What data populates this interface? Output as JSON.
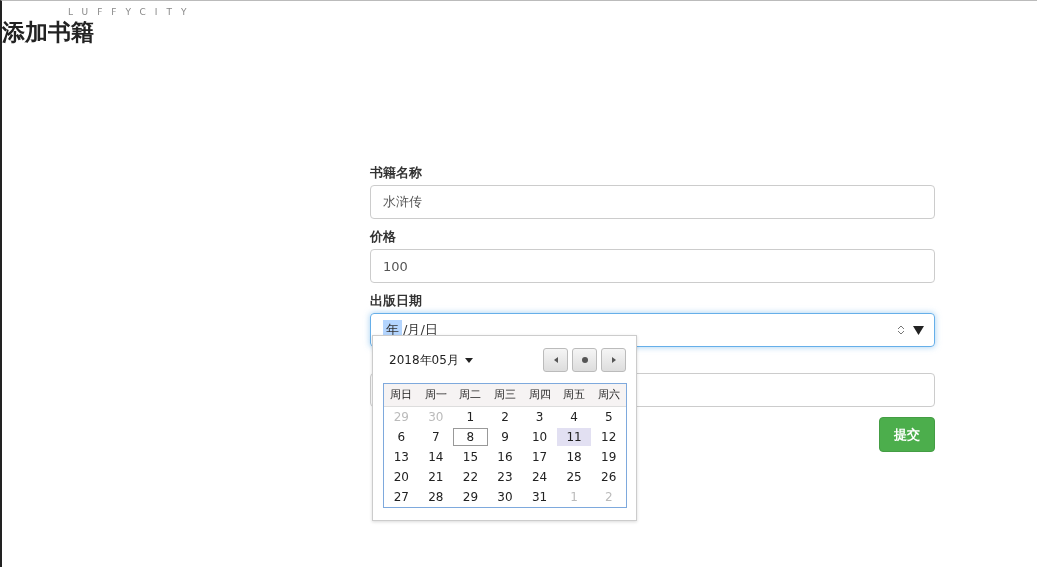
{
  "logo": "LUFFYCITY",
  "title": "添加书籍",
  "fields": [
    {
      "label": "书籍名称",
      "value": "水浒传"
    },
    {
      "label": "价格",
      "value": "100"
    },
    {
      "label": "出版日期",
      "kind": "date",
      "segments": [
        "年",
        "/月/日"
      ],
      "focused": true
    }
  ],
  "datepicker": {
    "month": "2018年05月",
    "weekdays": [
      "周日",
      "周一",
      "周二",
      "周三",
      "周四",
      "周五",
      "周六"
    ],
    "weeks": [
      [
        {
          "label": "29",
          "other_month": true,
          "today": false,
          "hovered": false
        },
        {
          "label": "30",
          "other_month": true,
          "today": false,
          "hovered": false
        },
        {
          "label": "1",
          "other_month": false,
          "today": false,
          "hovered": false
        },
        {
          "label": "2",
          "other_month": false,
          "today": false,
          "hovered": false
        },
        {
          "label": "3",
          "other_month": false,
          "today": false,
          "hovered": false
        },
        {
          "label": "4",
          "other_month": false,
          "today": false,
          "hovered": false
        },
        {
          "label": "5",
          "other_month": false,
          "today": false,
          "hovered": false
        }
      ],
      [
        {
          "label": "6",
          "other_month": false,
          "today": false,
          "hovered": false
        },
        {
          "label": "7",
          "other_month": false,
          "today": false,
          "hovered": false
        },
        {
          "label": "8",
          "other_month": false,
          "today": true,
          "hovered": false
        },
        {
          "label": "9",
          "other_month": false,
          "today": false,
          "hovered": false
        },
        {
          "label": "10",
          "other_month": false,
          "today": false,
          "hovered": false
        },
        {
          "label": "11",
          "other_month": false,
          "today": false,
          "hovered": true
        },
        {
          "label": "12",
          "other_month": false,
          "today": false,
          "hovered": false
        }
      ],
      [
        {
          "label": "13",
          "other_month": false,
          "today": false,
          "hovered": false
        },
        {
          "label": "14",
          "other_month": false,
          "today": false,
          "hovered": false
        },
        {
          "label": "15",
          "other_month": false,
          "today": false,
          "hovered": false
        },
        {
          "label": "16",
          "other_month": false,
          "today": false,
          "hovered": false
        },
        {
          "label": "17",
          "other_month": false,
          "today": false,
          "hovered": false
        },
        {
          "label": "18",
          "other_month": false,
          "today": false,
          "hovered": false
        },
        {
          "label": "19",
          "other_month": false,
          "today": false,
          "hovered": false
        }
      ],
      [
        {
          "label": "20",
          "other_month": false,
          "today": false,
          "hovered": false
        },
        {
          "label": "21",
          "other_month": false,
          "today": false,
          "hovered": false
        },
        {
          "label": "22",
          "other_month": false,
          "today": false,
          "hovered": false
        },
        {
          "label": "23",
          "other_month": false,
          "today": false,
          "hovered": false
        },
        {
          "label": "24",
          "other_month": false,
          "today": false,
          "hovered": false
        },
        {
          "label": "25",
          "other_month": false,
          "today": false,
          "hovered": false
        },
        {
          "label": "26",
          "other_month": false,
          "today": false,
          "hovered": false
        }
      ],
      [
        {
          "label": "27",
          "other_month": false,
          "today": false,
          "hovered": false
        },
        {
          "label": "28",
          "other_month": false,
          "today": false,
          "hovered": false
        },
        {
          "label": "29",
          "other_month": false,
          "today": false,
          "hovered": false
        },
        {
          "label": "30",
          "other_month": false,
          "today": false,
          "hovered": false
        },
        {
          "label": "31",
          "other_month": false,
          "today": false,
          "hovered": false
        },
        {
          "label": "1",
          "other_month": true,
          "today": false,
          "hovered": false
        },
        {
          "label": "2",
          "other_month": true,
          "today": false,
          "hovered": false
        }
      ]
    ]
  },
  "submit": "提交"
}
